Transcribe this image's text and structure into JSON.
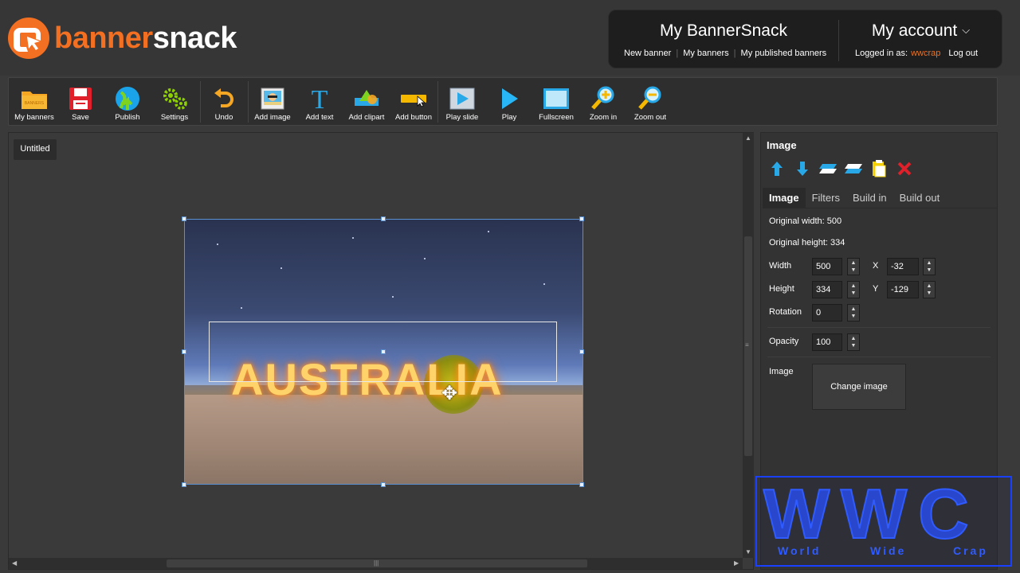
{
  "brand": {
    "banner": "banner",
    "snack": "snack",
    "color": "#f36f21"
  },
  "my_bannersnack": {
    "title": "My BannerSnack",
    "links": [
      "New banner",
      "My banners",
      "My published banners"
    ]
  },
  "account": {
    "title": "My account",
    "chevron": "⌄",
    "logged_in_label": "Logged in as:",
    "username": "wwcrap",
    "logout": "Log out"
  },
  "toolbar": {
    "items": [
      {
        "label": "My banners",
        "icon": "folder-icon"
      },
      {
        "label": "Save",
        "icon": "floppy-icon"
      },
      {
        "label": "Publish",
        "icon": "globe-icon"
      },
      {
        "label": "Settings",
        "icon": "gears-icon"
      },
      {
        "label": "Undo",
        "icon": "undo-icon"
      },
      {
        "label": "Add image",
        "icon": "image-icon"
      },
      {
        "label": "Add text",
        "icon": "text-icon"
      },
      {
        "label": "Add clipart",
        "icon": "clipart-icon"
      },
      {
        "label": "Add button",
        "icon": "button-icon"
      },
      {
        "label": "Play slide",
        "icon": "play-slide-icon"
      },
      {
        "label": "Play",
        "icon": "play-icon"
      },
      {
        "label": "Fullscreen",
        "icon": "fullscreen-icon"
      },
      {
        "label": "Zoom in",
        "icon": "zoom-in-icon"
      },
      {
        "label": "Zoom out",
        "icon": "zoom-out-icon"
      }
    ]
  },
  "canvas": {
    "doc_tab": "Untitled",
    "banner_text": "AUSTRALIA"
  },
  "properties": {
    "title": "Image",
    "tabs": [
      "Image",
      "Filters",
      "Build in",
      "Build out"
    ],
    "active_tab": "Image",
    "original_width_label": "Original width: 500",
    "original_height_label": "Original height: 334",
    "width_label": "Width",
    "width_value": "500",
    "x_label": "X",
    "x_value": "-32",
    "height_label": "Height",
    "height_value": "334",
    "y_label": "Y",
    "y_value": "-129",
    "rotation_label": "Rotation",
    "rotation_value": "0",
    "opacity_label": "Opacity",
    "opacity_value": "100",
    "image_label": "Image",
    "change_image_button": "Change image"
  },
  "watermark": {
    "big": "WWC",
    "words": [
      "World",
      "Wide",
      "Crap"
    ]
  }
}
